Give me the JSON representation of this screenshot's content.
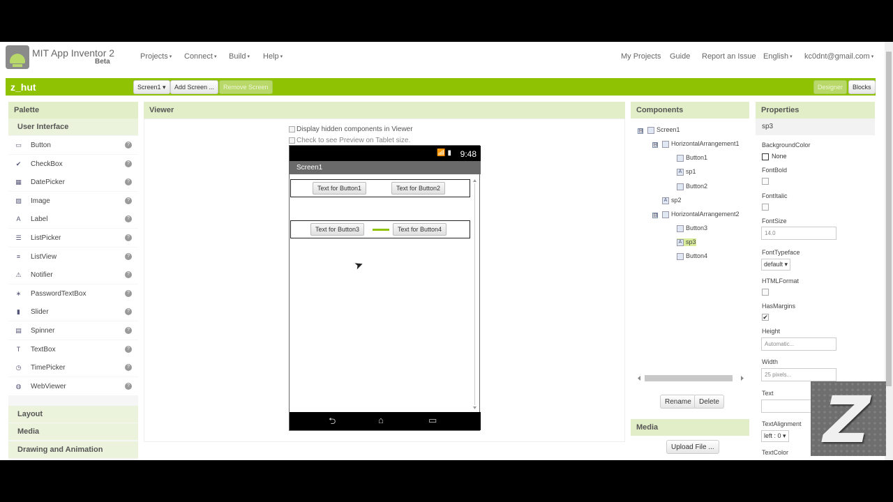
{
  "app": {
    "title": "MIT App Inventor 2",
    "subtitle": "Beta"
  },
  "nav": {
    "left": [
      "Projects",
      "Connect",
      "Build",
      "Help"
    ],
    "right": {
      "my_projects": "My Projects",
      "guide": "Guide",
      "report": "Report an Issue",
      "language": "English",
      "account": "kc0dnt@gmail.com"
    }
  },
  "toolbar": {
    "project_name": "z_hut",
    "screen_select": "Screen1",
    "add_screen": "Add Screen ...",
    "remove_screen": "Remove Screen",
    "designer": "Designer",
    "blocks": "Blocks"
  },
  "palette": {
    "title": "Palette",
    "category_open": "User Interface",
    "items": [
      {
        "label": "Button",
        "icon": "button-icon",
        "glyph": "▭"
      },
      {
        "label": "CheckBox",
        "icon": "checkbox-icon",
        "glyph": "✔"
      },
      {
        "label": "DatePicker",
        "icon": "datepicker-icon",
        "glyph": "▦"
      },
      {
        "label": "Image",
        "icon": "image-icon",
        "glyph": "▨"
      },
      {
        "label": "Label",
        "icon": "label-icon",
        "glyph": "A"
      },
      {
        "label": "ListPicker",
        "icon": "listpicker-icon",
        "glyph": "☰"
      },
      {
        "label": "ListView",
        "icon": "listview-icon",
        "glyph": "≡"
      },
      {
        "label": "Notifier",
        "icon": "notifier-icon",
        "glyph": "⚠"
      },
      {
        "label": "PasswordTextBox",
        "icon": "password-icon",
        "glyph": "∗"
      },
      {
        "label": "Slider",
        "icon": "slider-icon",
        "glyph": "▮"
      },
      {
        "label": "Spinner",
        "icon": "spinner-icon",
        "glyph": "▤"
      },
      {
        "label": "TextBox",
        "icon": "textbox-icon",
        "glyph": "T"
      },
      {
        "label": "TimePicker",
        "icon": "timepicker-icon",
        "glyph": "◷"
      },
      {
        "label": "WebViewer",
        "icon": "webviewer-icon",
        "glyph": "◍"
      }
    ],
    "help_glyph": "?",
    "categories_closed": [
      "Layout",
      "Media",
      "Drawing and Animation"
    ]
  },
  "viewer": {
    "title": "Viewer",
    "hidden_components_label": "Display hidden components in Viewer",
    "tablet_label": "Check to see Preview on Tablet size.",
    "phone": {
      "time": "9:48",
      "status_icons": "📶 ▮",
      "screen_title": "Screen1",
      "row1": [
        "Text for Button1",
        "Text for Button2"
      ],
      "row2": [
        "Text for Button3",
        "Text for Button4"
      ],
      "nav": {
        "back": "⮌",
        "home": "⌂",
        "recent": "▭"
      }
    }
  },
  "components": {
    "title": "Components",
    "tree": [
      {
        "label": "Screen1",
        "level": 0,
        "toggle": "⊟"
      },
      {
        "label": "HorizontalArrangement1",
        "level": 1,
        "toggle": "⊟"
      },
      {
        "label": "Button1",
        "level": 2
      },
      {
        "label": "sp1",
        "level": 2
      },
      {
        "label": "Button2",
        "level": 2
      },
      {
        "label": "sp2",
        "level": 1
      },
      {
        "label": "HorizontalArrangement2",
        "level": 1,
        "toggle": "⊟"
      },
      {
        "label": "Button3",
        "level": 2
      },
      {
        "label": "sp3",
        "level": 2,
        "selected": true
      },
      {
        "label": "Button4",
        "level": 2
      }
    ],
    "rename": "Rename",
    "delete": "Delete"
  },
  "media": {
    "title": "Media",
    "upload": "Upload File ..."
  },
  "properties": {
    "title": "Properties",
    "component": "sp3",
    "background_color_label": "BackgroundColor",
    "background_color_value": "None",
    "fontbold_label": "FontBold",
    "fontitalic_label": "FontItalic",
    "fontsize_label": "FontSize",
    "fontsize_value": "14.0",
    "fonttypeface_label": "FontTypeface",
    "fonttypeface_value": "default",
    "htmlformat_label": "HTMLFormat",
    "hasmargins_label": "HasMargins",
    "height_label": "Height",
    "height_value": "Automatic...",
    "width_label": "Width",
    "width_value": "25 pixels...",
    "text_label": "Text",
    "textalignment_label": "TextAlignment",
    "textalignment_value": "left : 0",
    "textcolor_label": "TextColor"
  },
  "watermark": {
    "letter": "Z"
  },
  "colors": {
    "accent": "#8fc202",
    "panel_header": "#e2eec7",
    "selected": "#d8ec9a"
  }
}
